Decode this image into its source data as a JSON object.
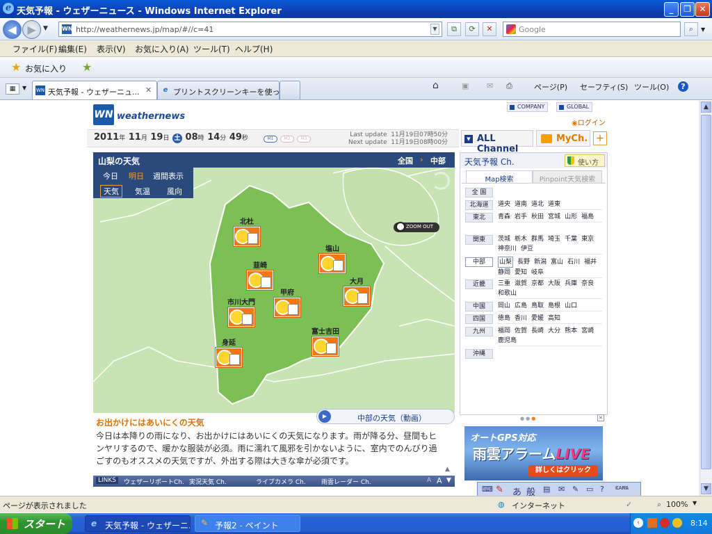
{
  "window": {
    "title": "天気予報 - ウェザーニュース - Windows Internet Explorer",
    "minimize": "_",
    "maximize": "❐",
    "close": "✕"
  },
  "browser": {
    "url": "http://weathernews.jp/map/#//c=41",
    "search_placeholder": "Google",
    "menu": [
      "ファイル(F)",
      "編集(E)",
      "表示(V)",
      "お気に入り(A)",
      "ツール(T)",
      "ヘルプ(H)"
    ],
    "favorites_label": "お気に入り",
    "tabs": [
      {
        "label": "天気予報 - ウェザーニュ..."
      },
      {
        "label": "プリントスクリーンキーを使って..."
      }
    ],
    "tab_close": "✕",
    "commands": {
      "page": "ページ(P)",
      "safety": "セーフティ(S)",
      "tools": "ツール(O)",
      "help": "?"
    },
    "status_text": "ページが表示されました",
    "zone": "インターネット",
    "zoom": "100%"
  },
  "site": {
    "logo": "WN",
    "brand": "weathernews",
    "links": {
      "company": "COMPANY",
      "global": "GLOBAL"
    },
    "login": "ログイン",
    "date": {
      "year": "2011",
      "month": "11",
      "day": "19",
      "dow": "土",
      "hour": "08",
      "minute": "14",
      "second": "49"
    },
    "date_units": {
      "year": "年",
      "month": "月",
      "day": "日",
      "hour": "時",
      "minute": "分",
      "second": "秒"
    },
    "pills": [
      "M1",
      "M2",
      "M3"
    ],
    "last_update_label": "Last update",
    "last_update": "11月19日07時50分",
    "next_update_label": "Next update",
    "next_update": "11月19日08時00分",
    "all_channel": "ALL Channel",
    "mych": "MyCh.",
    "plus": "+"
  },
  "map": {
    "title": "山梨の天気",
    "nav_all": "全国",
    "nav_region": "中部",
    "day_tabs": [
      "今日",
      "明日",
      "週間表示"
    ],
    "mode_tabs": [
      "天気",
      "気温",
      "風向"
    ],
    "zoom_out": "ZOOM OUT",
    "locations": [
      {
        "name": "北杜",
        "icon": "sunny-then-cloudy"
      },
      {
        "name": "塩山",
        "icon": "sunny-then-cloudy"
      },
      {
        "name": "韮崎",
        "icon": "sunny-then-cloudy"
      },
      {
        "name": "大月",
        "icon": "sunny-then-cloudy"
      },
      {
        "name": "甲府",
        "icon": "sunny-then-cloudy"
      },
      {
        "name": "市川大門",
        "icon": "sunny-then-cloudy"
      },
      {
        "name": "富士吉田",
        "icon": "sunny-then-cloudy"
      },
      {
        "name": "身延",
        "icon": "sunny-then-cloudy"
      }
    ],
    "video_label": "中部の天気（動画）"
  },
  "outing": {
    "title": "お出かけにはあいにくの天気",
    "body": "今日は本降りの雨になり、お出かけにはあいにくの天気になります。雨が降る分、昼間もヒンヤリするので、暖かな服装が必須。雨に濡れて風邪を引かないように、室内でのんびり過ごすのもオススメの天気ですが、外出する際は大きな傘が必須です。"
  },
  "links_bar": {
    "label": "LINKS",
    "items": [
      "ウェザーリポートCh.",
      "実況天気 Ch.",
      "ライブカメラ Ch.",
      "雨雲レーダー Ch."
    ]
  },
  "side": {
    "title": "天気予報 Ch.",
    "usage": "使い方",
    "tabs": [
      "Map検索",
      "Pinpoint天気検索"
    ],
    "national": "全 国",
    "regions": [
      {
        "name": "北海道",
        "prefs": [
          "道央",
          "道南",
          "道北",
          "道東"
        ]
      },
      {
        "name": "東北",
        "prefs": [
          "青森",
          "岩手",
          "秋田",
          "宮城",
          "山形",
          "福島"
        ]
      },
      {
        "name": "関東",
        "prefs": [
          "茨城",
          "栃木",
          "群馬",
          "埼玉",
          "千葉",
          "東京",
          "神奈川",
          "伊豆"
        ]
      },
      {
        "name": "中部",
        "prefs": [
          "山梨",
          "長野",
          "新潟",
          "富山",
          "石川",
          "福井",
          "静岡",
          "愛知",
          "岐阜"
        ]
      },
      {
        "name": "近畿",
        "prefs": [
          "三重",
          "滋賀",
          "京都",
          "大阪",
          "兵庫",
          "奈良",
          "和歌山"
        ]
      },
      {
        "name": "中国",
        "prefs": [
          "岡山",
          "広島",
          "鳥取",
          "島根",
          "山口"
        ]
      },
      {
        "name": "四国",
        "prefs": [
          "徳島",
          "香川",
          "愛媛",
          "高知"
        ]
      },
      {
        "name": "九州",
        "prefs": [
          "福岡",
          "佐賀",
          "長崎",
          "大分",
          "熊本",
          "宮崎",
          "鹿児島"
        ]
      },
      {
        "name": "沖縄",
        "prefs": []
      }
    ],
    "ad": {
      "line1": "オートGPS対応",
      "line2": "雨雲アラーム",
      "line2b": "LIVE",
      "cta": "詳しくはクリック"
    }
  },
  "ime": {
    "mode1": "あ",
    "mode2": "般",
    "caps": "CAPS",
    "kana": "KANA"
  },
  "taskbar": {
    "start": "スタート",
    "tasks": [
      "天気予報 - ウェザーニ...",
      "予報2 - ペイント"
    ],
    "clock": "8:14"
  }
}
